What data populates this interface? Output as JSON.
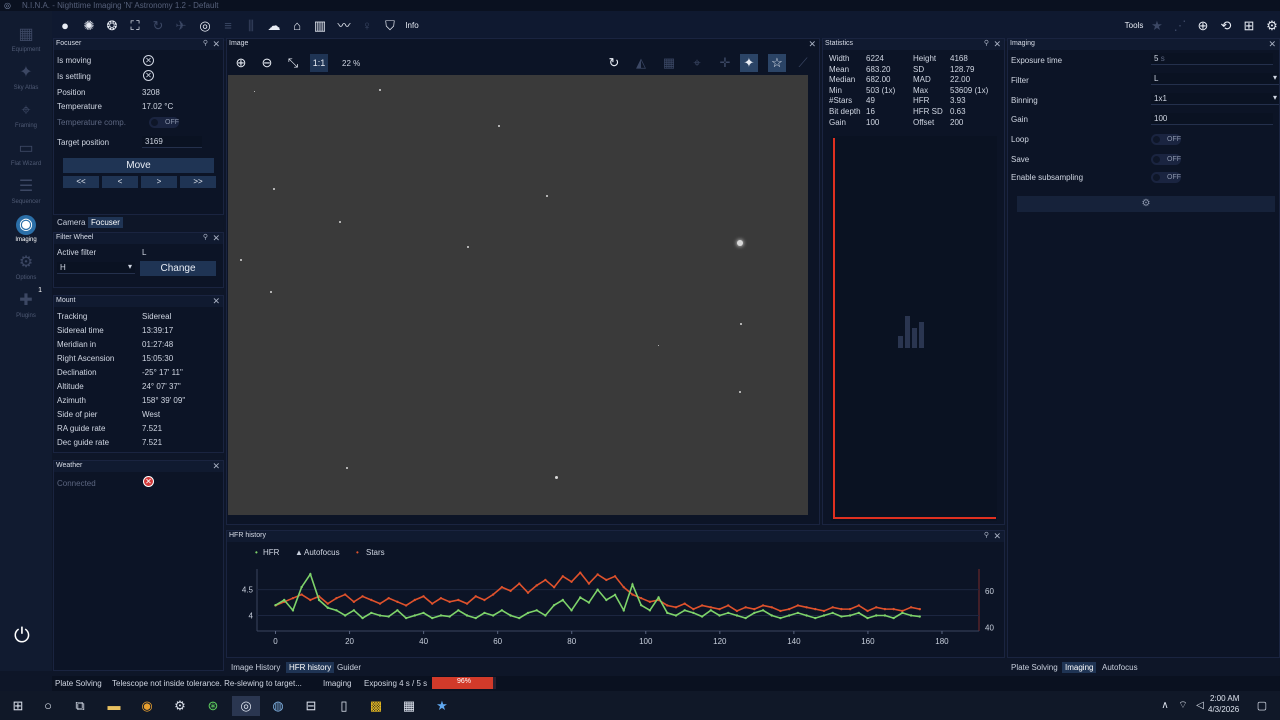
{
  "window": {
    "title": "N.I.N.A. - Nighttime Imaging 'N' Astronomy 1.2 - Default"
  },
  "nav": {
    "equipment": "Equipment",
    "skyatlas": "Sky Atlas",
    "framing": "Framing",
    "flatwizard": "Flat Wizard",
    "sequencer": "Sequencer",
    "imaging": "Imaging",
    "options": "Options",
    "plugins": "Plugins",
    "plugins_badge": "1"
  },
  "toolbar": {
    "info": "Info",
    "tools": "Tools"
  },
  "focuser": {
    "title": "Focuser",
    "is_moving": "Is moving",
    "is_settling": "Is settling",
    "position_label": "Position",
    "position": "3208",
    "temperature_label": "Temperature",
    "temperature": "17.02 °C",
    "tempcomp_label": "Temperature comp.",
    "tempcomp": "OFF",
    "target_label": "Target position",
    "target": "3169",
    "move": "Move",
    "b1": "<<",
    "b2": "<",
    "b3": ">",
    "b4": ">>"
  },
  "tabs_left": {
    "camera": "Camera",
    "focuser": "Focuser"
  },
  "filterwheel": {
    "title": "Filter Wheel",
    "active_label": "Active filter",
    "active": "L",
    "selected": "H",
    "change": "Change"
  },
  "mount": {
    "title": "Mount",
    "rows": [
      [
        "Tracking",
        "Sidereal"
      ],
      [
        "Sidereal time",
        "13:39:17"
      ],
      [
        "Meridian in",
        "01:27:48"
      ],
      [
        "Right Ascension",
        "15:05:30"
      ],
      [
        "Declination",
        "-25° 17' 11\""
      ],
      [
        "Altitude",
        "24° 07' 37\""
      ],
      [
        "Azimuth",
        "158° 39' 09\""
      ],
      [
        "Side of pier",
        "West"
      ],
      [
        "RA guide rate",
        "7.521"
      ],
      [
        "Dec guide rate",
        "7.521"
      ]
    ]
  },
  "weather": {
    "title": "Weather",
    "connected": "Connected"
  },
  "image": {
    "title": "Image",
    "zoom_11": "1:1",
    "zoom": "22 %"
  },
  "statistics": {
    "title": "Statistics",
    "left": [
      [
        "Width",
        "6224"
      ],
      [
        "Mean",
        "683.20"
      ],
      [
        "Median",
        "682.00"
      ],
      [
        "Min",
        "503 (1x)"
      ],
      [
        "#Stars",
        "49"
      ],
      [
        "Bit depth",
        "16"
      ],
      [
        "Gain",
        "100"
      ]
    ],
    "right": [
      [
        "Height",
        "4168"
      ],
      [
        "SD",
        "128.79"
      ],
      [
        "MAD",
        "22.00"
      ],
      [
        "Max",
        "53609 (1x)"
      ],
      [
        "HFR",
        "3.93"
      ],
      [
        "HFR SD",
        "0.63"
      ],
      [
        "Offset",
        "200"
      ]
    ]
  },
  "imaging": {
    "title": "Imaging",
    "exposure_label": "Exposure time",
    "exposure": "5",
    "exposure_unit": "s",
    "filter_label": "Filter",
    "filter": "L",
    "binning_label": "Binning",
    "binning": "1x1",
    "gain_label": "Gain",
    "gain": "100",
    "loop_label": "Loop",
    "loop": "OFF",
    "save_label": "Save",
    "save": "OFF",
    "subsampling_label": "Enable subsampling",
    "subsampling": "OFF"
  },
  "hfr": {
    "title": "HFR history",
    "legend_hfr": "HFR",
    "legend_af": "Autofocus",
    "legend_stars": "Stars"
  },
  "chart_data": {
    "type": "line",
    "xlabel": "",
    "ylabel": "",
    "xlim": [
      -5,
      190
    ],
    "xticks": [
      "0",
      "20",
      "40",
      "60",
      "80",
      "100",
      "120",
      "140",
      "160",
      "180"
    ],
    "y_left_ticks": [
      "4",
      "4.5"
    ],
    "y_right_ticks": [
      "40",
      "60"
    ],
    "y_left_lim": [
      3.7,
      4.9
    ],
    "y_right_lim": [
      38,
      72
    ],
    "series": [
      {
        "name": "HFR",
        "axis": "left",
        "color": "#7ed36a",
        "values": [
          4.2,
          4.3,
          4.1,
          4.55,
          4.8,
          4.3,
          4.15,
          4.1,
          4.0,
          4.1,
          3.95,
          4.05,
          4.0,
          3.98,
          4.1,
          3.95,
          4.0,
          4.05,
          3.95,
          4.0,
          3.98,
          4.1,
          4.0,
          3.95,
          4.05,
          4.0,
          4.1,
          4.0,
          3.95,
          4.05,
          4.1,
          4.0,
          4.2,
          4.3,
          4.1,
          4.35,
          4.25,
          4.5,
          4.3,
          4.4,
          4.1,
          4.6,
          4.2,
          4.1,
          4.35,
          4.05,
          4.0,
          4.1,
          4.05,
          3.98,
          4.1,
          4.0,
          4.05,
          4.0,
          3.95,
          4.05,
          4.1,
          4.0,
          3.95,
          4.0,
          4.05,
          4.0,
          3.95,
          4.0,
          4.05,
          3.98,
          4.0,
          4.05,
          3.95,
          4.0,
          4.0,
          3.95,
          4.05,
          4.0,
          3.98
        ]
      },
      {
        "name": "Stars",
        "axis": "right",
        "color": "#e0522c",
        "values": [
          52,
          54,
          56,
          58,
          55,
          57,
          53,
          56,
          58,
          54,
          57,
          55,
          53,
          56,
          54,
          52,
          55,
          57,
          53,
          56,
          54,
          55,
          53,
          57,
          55,
          58,
          62,
          60,
          64,
          59,
          63,
          66,
          62,
          68,
          65,
          70,
          64,
          69,
          66,
          68,
          62,
          58,
          56,
          54,
          55,
          52,
          51,
          53,
          50,
          52,
          51,
          50,
          52,
          49,
          51,
          50,
          52,
          51,
          49,
          50,
          52,
          51,
          50,
          49,
          51,
          50,
          50,
          52,
          49,
          51,
          50,
          50,
          49,
          51,
          50
        ]
      }
    ]
  },
  "bottom_tabs": {
    "history": "Image History",
    "hfr": "HFR history",
    "guider": "Guider"
  },
  "right_tabs": {
    "plate": "Plate Solving",
    "imaging": "Imaging",
    "autofocus": "Autofocus"
  },
  "status": {
    "plate": "Plate Solving",
    "plate_msg": "Telescope not inside tolerance. Re-slewing to target...",
    "imaging": "Imaging",
    "imaging_msg": "Exposing 4 s / 5 s",
    "progress_label": "96%",
    "progress": 0.96
  },
  "taskbar": {
    "time": "2:00 AM",
    "date": "4/3/2026"
  }
}
